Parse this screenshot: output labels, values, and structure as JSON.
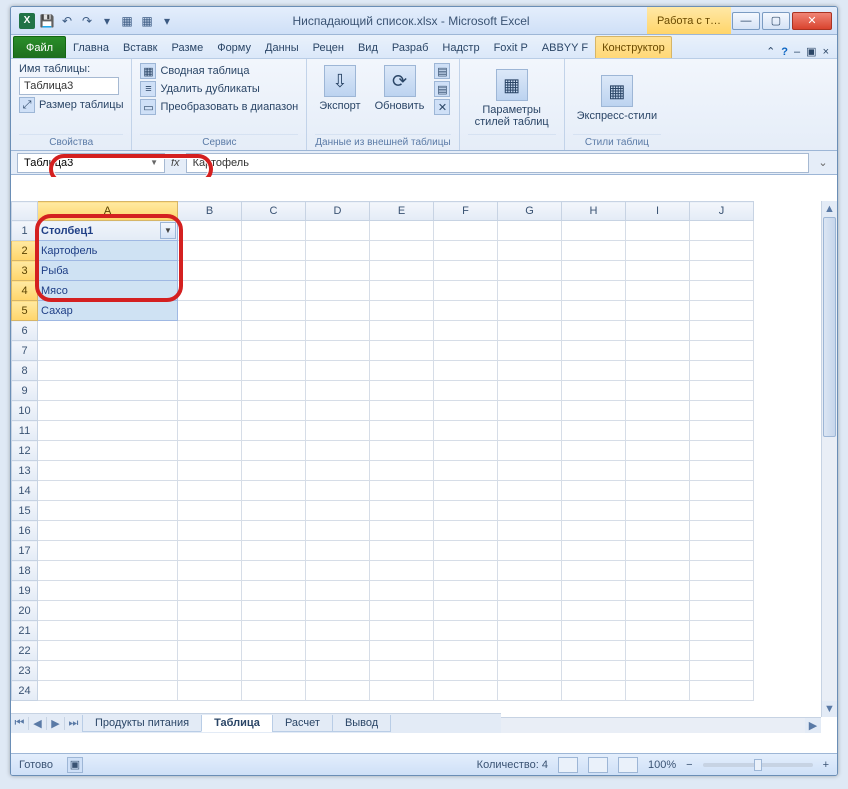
{
  "titlebar": {
    "app_icon_letter": "X",
    "title": "Ниспадающий список.xlsx - Microsoft Excel",
    "contextual_label": "Работа с т…"
  },
  "tabs": {
    "file": "Файл",
    "items": [
      "Главна",
      "Вставк",
      "Разме",
      "Форму",
      "Данны",
      "Рецен",
      "Вид",
      "Разраб",
      "Надстр",
      "Foxit P",
      "ABBYY F"
    ],
    "contextual": "Конструктор"
  },
  "ribbon": {
    "group1": {
      "title": "Свойства",
      "label_name": "Имя таблицы:",
      "table_name_value": "Таблица3",
      "resize": "Размер таблицы"
    },
    "group2": {
      "title": "Сервис",
      "pivot": "Сводная таблица",
      "dedup": "Удалить дубликаты",
      "convert": "Преобразовать в диапазон"
    },
    "group3": {
      "title": "Данные из внешней таблицы",
      "export": "Экспорт",
      "refresh": "Обновить"
    },
    "group4": {
      "title": "",
      "params": "Параметры стилей таблиц"
    },
    "group5": {
      "title": "Стили таблиц",
      "express": "Экспресс-стили"
    }
  },
  "namebox": {
    "value": "Таблица3"
  },
  "formula": {
    "fx": "fx",
    "value": "Картофель"
  },
  "columns": [
    "A",
    "B",
    "C",
    "D",
    "E",
    "F",
    "G",
    "H",
    "I",
    "J"
  ],
  "rows_count": 24,
  "table": {
    "header": "Столбец1",
    "rows": [
      "Картофель",
      "Рыба",
      "Мясо",
      "Сахар"
    ]
  },
  "sheet_tabs": {
    "items": [
      "Продукты питания",
      "Таблица",
      "Расчет",
      "Вывод"
    ],
    "active_index": 1
  },
  "statusbar": {
    "ready": "Готово",
    "count_label": "Количество: 4",
    "zoom": "100%"
  }
}
